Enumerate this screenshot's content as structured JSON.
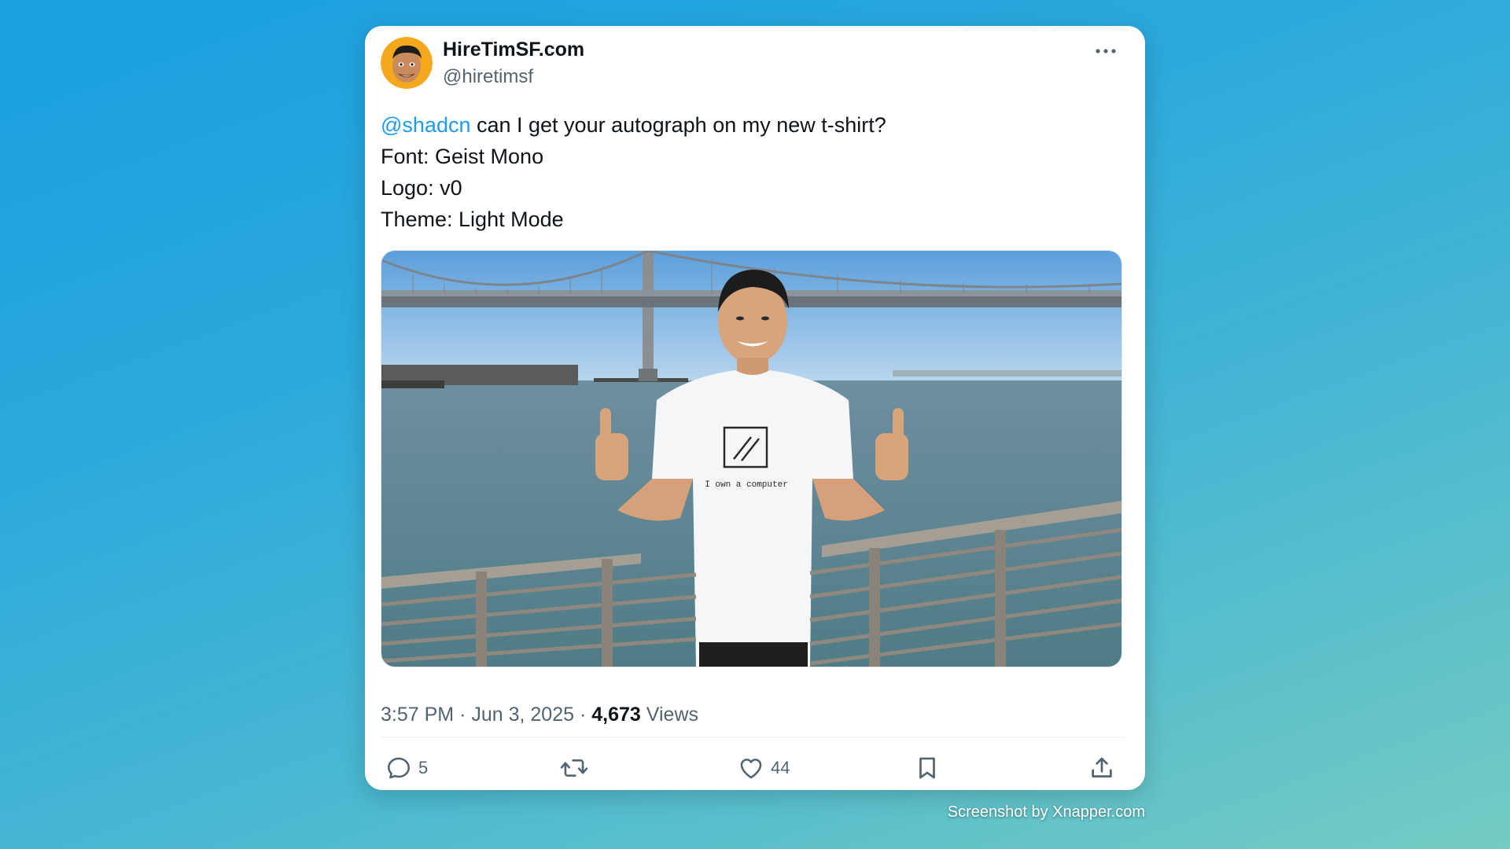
{
  "tweet": {
    "author": {
      "display_name": "HireTimSF.com",
      "handle": "@hiretimsf",
      "avatar_icon": "avatar-photo"
    },
    "more_icon": "more-horizontal-icon",
    "text": {
      "mention": "@shadcn",
      "line1_rest": " can I get your autograph on my new t-shirt?",
      "line2": "Font: Geist Mono",
      "line3": "Logo: v0",
      "line4": "Theme: Light Mode"
    },
    "media": {
      "shirt_text": "I own a computer"
    },
    "meta": {
      "time": "3:57 PM",
      "separator": "·",
      "date": "Jun 3, 2025",
      "views_count": "4,673",
      "views_label": "Views"
    },
    "actions": {
      "reply": {
        "icon": "reply-icon",
        "count": "5"
      },
      "repost": {
        "icon": "repost-icon",
        "count": ""
      },
      "like": {
        "icon": "heart-icon",
        "count": "44"
      },
      "bookmark": {
        "icon": "bookmark-icon"
      },
      "share": {
        "icon": "share-icon"
      }
    }
  },
  "watermark": "Screenshot by Xnapper.com",
  "colors": {
    "link": "#1d9bf0",
    "text_primary": "#0f1419",
    "text_secondary": "#536471",
    "background_top": "#1a9fe0",
    "background_bottom": "#74cbc2"
  }
}
